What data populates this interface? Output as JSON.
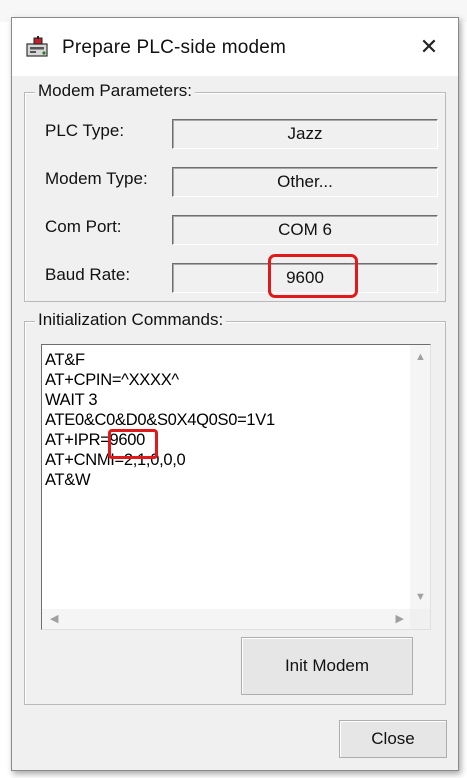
{
  "window": {
    "title": "Prepare PLC-side modem",
    "close_glyph": "✕",
    "icon": "modem-app-icon"
  },
  "modem_parameters": {
    "legend": "Modem Parameters:",
    "rows": [
      {
        "label": "PLC Type:",
        "value": "Jazz"
      },
      {
        "label": "Modem Type:",
        "value": "Other..."
      },
      {
        "label": "Com Port:",
        "value": "COM 6"
      },
      {
        "label": "Baud Rate:",
        "value": "9600"
      }
    ]
  },
  "init_commands": {
    "legend": "Initialization Commands:",
    "lines": [
      "AT&F",
      "AT+CPIN=^XXXX^",
      "WAIT 3",
      "ATE0&C0&D0&S0X4Q0S0=1V1",
      "AT+IPR=9600",
      "AT+CNMI=2,1,0,0,0",
      "AT&W"
    ]
  },
  "buttons": {
    "init_modem": "Init Modem",
    "close": "Close"
  },
  "colors": {
    "highlight": "#e01a1a",
    "dialog_bg": "#f0f0f0"
  }
}
